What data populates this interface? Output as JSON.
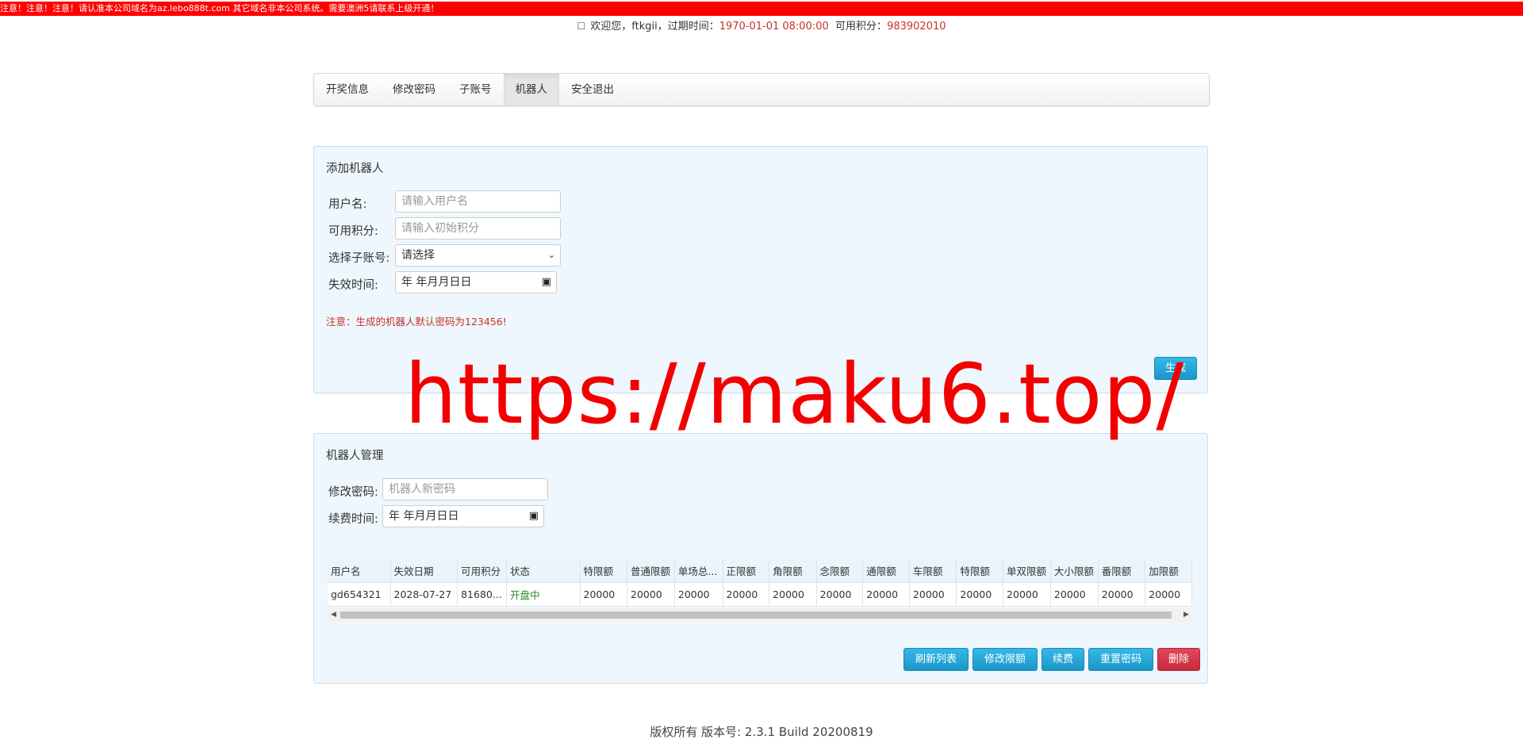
{
  "banner": {
    "text": "注意！注意！注意！请认准本公司域名为az.lebo888t.com 其它域名非本公司系统。需要澳洲5请联系上级开通！"
  },
  "user_bar": {
    "icon": "user-icon",
    "welcome": "欢迎您，ftkgii，过期时间：",
    "expire": "1970-01-01 08:00:00",
    "points_label": "可用积分：",
    "points": "983902010"
  },
  "nav": {
    "tabs": [
      {
        "label": "开奖信息",
        "active": false
      },
      {
        "label": "修改密码",
        "active": false
      },
      {
        "label": "子账号",
        "active": false
      },
      {
        "label": "机器人",
        "active": true
      },
      {
        "label": "安全退出",
        "active": false
      }
    ]
  },
  "add_robot": {
    "title": "添加机器人",
    "username_label": "用户名:",
    "username_placeholder": "请输入用户名",
    "points_label": "可用积分:",
    "points_placeholder": "请输入初始积分",
    "subaccount_label": "选择子账号:",
    "subaccount_value": "请选择",
    "expire_label": "失效时间:",
    "expire_value": "年 年月月日日",
    "notice": "注意：生成的机器人默认密码为123456!",
    "generate_button": "生成"
  },
  "watermark": {
    "text": "https://maku6.top/"
  },
  "robot_manage": {
    "title": "机器人管理",
    "password_label": "修改密码:",
    "password_placeholder": "机器人新密码",
    "renew_label": "续费时间:",
    "renew_value": "年 年月月日日",
    "columns": [
      "用户名",
      "失效日期",
      "可用积分",
      "状态",
      "特限额",
      "普通限额",
      "单场总...",
      "正限额",
      "角限额",
      "念限额",
      "通限额",
      "车限额",
      "特限额",
      "单双限额",
      "大小限额",
      "番限额",
      "加限额"
    ],
    "rows": [
      [
        "gd654321",
        "2028-07-27",
        "81680...",
        "开盘中",
        "20000",
        "20000",
        "20000",
        "20000",
        "20000",
        "20000",
        "20000",
        "20000",
        "20000",
        "20000",
        "20000",
        "20000",
        "20000"
      ]
    ],
    "buttons": {
      "refresh": "刷新列表",
      "modify_limit": "修改限额",
      "renew": "续费",
      "reset_password": "重置密码",
      "delete": "删除"
    }
  },
  "footer": {
    "text": "版权所有 版本号: 2.3.1 Build 20200819"
  },
  "colors": {
    "banner": "#ff0000",
    "accent": "#1b97c8",
    "danger": "#c72a3b",
    "panel": "#eef7fd",
    "status_open": "#2f8a20"
  }
}
